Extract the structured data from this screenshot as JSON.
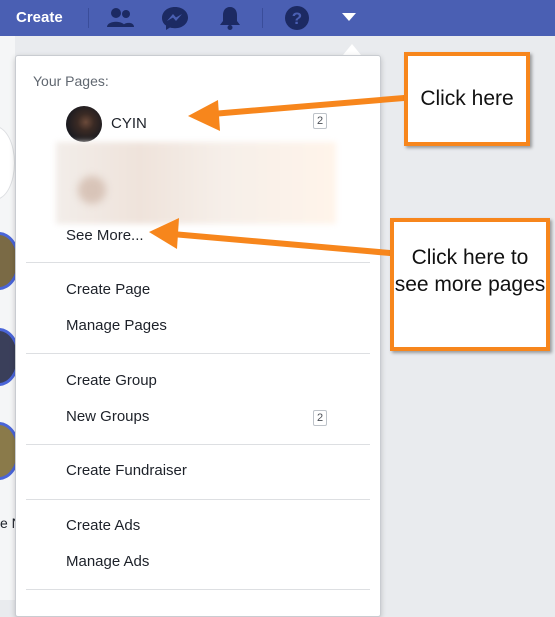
{
  "topbar": {
    "create_label": "Create",
    "icons": [
      "friends-icon",
      "messenger-icon",
      "notifications-icon",
      "help-icon",
      "dropdown-caret-icon"
    ]
  },
  "menu": {
    "your_pages_header": "Your Pages:",
    "pages": [
      {
        "name": "CYIN",
        "badge": "2"
      }
    ],
    "see_more": "See More...",
    "sections": [
      [
        "Create Page",
        "Manage Pages"
      ],
      [
        "Create Group",
        "New Groups"
      ],
      [
        "Create Fundraiser"
      ],
      [
        "Create Ads",
        "Manage Ads"
      ]
    ],
    "new_groups_badge": "2"
  },
  "background": {
    "partial_text": "e N"
  },
  "annotations": {
    "callout_1": "Click here",
    "callout_2": "Click here to see more pages",
    "accent_color": "#f7861c"
  },
  "colors": {
    "topbar": "#4a5fb3"
  }
}
